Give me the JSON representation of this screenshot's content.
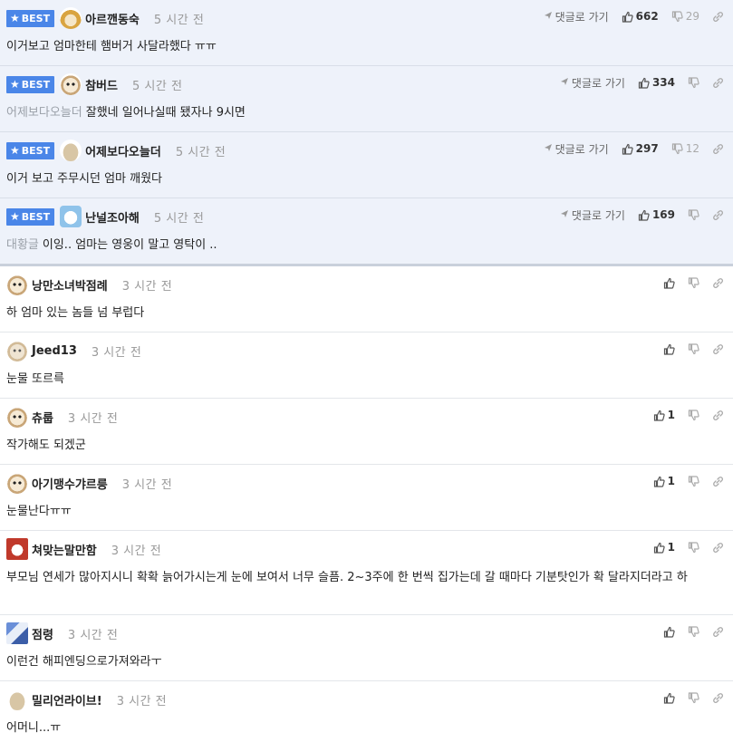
{
  "labels": {
    "best": "BEST",
    "reply": "댓글로 가기"
  },
  "colors": {
    "best_badge": "#4a86e8",
    "best_row_bg": "#eef2fa"
  },
  "comments": [
    {
      "best": true,
      "avatar": "fox-icon",
      "nick": "아르깬동숙",
      "time": "5 시간 전",
      "ref": "",
      "text": "이거보고 엄마한테 햄버거 사달라했다 ㅠㅠ",
      "up": "662",
      "down": "29"
    },
    {
      "best": true,
      "avatar": "puppy-icon",
      "nick": "참버드",
      "time": "5 시간 전",
      "ref": "어제보다오늘더",
      "text": "잘했네 일어나실때 됐자나 9시면",
      "up": "334",
      "down": ""
    },
    {
      "best": true,
      "avatar": "blob-icon",
      "nick": "어제보다오늘더",
      "time": "5 시간 전",
      "ref": "",
      "text": "이거 보고 주무시던 엄마 깨웠다",
      "up": "297",
      "down": "12"
    },
    {
      "best": true,
      "avatar": "snow-icon",
      "nick": "난널조아해",
      "time": "5 시간 전",
      "ref": "대황글",
      "text": "이잉.. 엄마는 영웅이 말고 영탁이 ..",
      "up": "169",
      "down": ""
    },
    {
      "best": false,
      "avatar": "puppy-icon",
      "nick": "낭만소녀박점례",
      "time": "3 시간 전",
      "ref": "",
      "text": "하 엄마 있는 놈들 넘 부럽다",
      "up": "",
      "down": ""
    },
    {
      "best": false,
      "avatar": "puppy-light-icon",
      "nick": "Jeed13",
      "time": "3 시간 전",
      "ref": "",
      "text": "눈물 또르륵",
      "up": "",
      "down": ""
    },
    {
      "best": false,
      "avatar": "puppy-icon",
      "nick": "츄룹",
      "time": "3 시간 전",
      "ref": "",
      "text": "작가해도 되겠군",
      "up": "1",
      "down": ""
    },
    {
      "best": false,
      "avatar": "puppy-icon",
      "nick": "아기맹수갸르릉",
      "time": "3 시간 전",
      "ref": "",
      "text": "눈물난다ㅠㅠ",
      "up": "1",
      "down": ""
    },
    {
      "best": false,
      "avatar": "red-dog-icon",
      "nick": "쳐맞는말만함",
      "time": "3 시간 전",
      "ref": "",
      "text": "부모님 연세가 많아지시니 확확 늙어가시는게 눈에 보여서 너무 슬픔. 2~3주에 한 번씩 집가는데 갈 때마다 기분탓인가 확 달라지더라고 하",
      "up": "1",
      "down": ""
    },
    {
      "best": false,
      "avatar": "blue-pixel-icon",
      "nick": "점령",
      "time": "3 시간 전",
      "ref": "",
      "text": "이런건 해피엔딩으로가져와라ㅜ",
      "up": "",
      "down": ""
    },
    {
      "best": false,
      "avatar": "blob-icon",
      "nick": "밀리언라이브!",
      "time": "3 시간 전",
      "ref": "",
      "text": "어머니...ㅠ",
      "up": "",
      "down": ""
    }
  ]
}
